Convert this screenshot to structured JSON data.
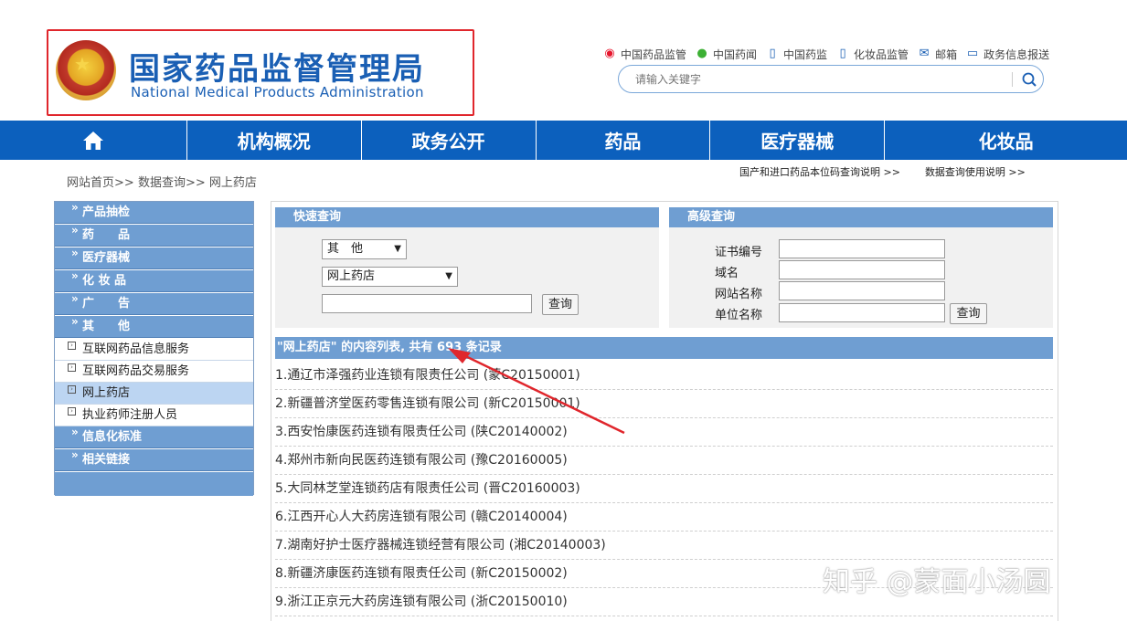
{
  "header": {
    "title_zh": "国家药品监督管理局",
    "title_en": "National Medical Products Administration",
    "quick_links": [
      {
        "label": "中国药品监管",
        "icon": "weibo-icon"
      },
      {
        "label": "中国药闻",
        "icon": "wechat-icon"
      },
      {
        "label": "中国药监",
        "icon": "mobile-icon"
      },
      {
        "label": "化妆品监管",
        "icon": "mobile-icon"
      },
      {
        "label": "邮箱",
        "icon": "mail-icon"
      },
      {
        "label": "政务信息报送",
        "icon": "monitor-icon"
      }
    ],
    "search": {
      "placeholder": "请输入关键字"
    }
  },
  "nav": {
    "items": [
      "机构概况",
      "政务公开",
      "药品",
      "医疗器械",
      "化妆品"
    ]
  },
  "breadcrumb": {
    "items": [
      "网站首页",
      "数据查询",
      "网上药店"
    ],
    "separator": ">>"
  },
  "help_links": [
    "国产和进口药品本位码查询说明 >>",
    "数据查询使用说明 >>"
  ],
  "sidebar": {
    "categories_top": [
      "产品抽检",
      "药　　品",
      "医疗器械",
      "化 妆 品",
      "广　　告",
      "其　　他"
    ],
    "sub_items": [
      "互联网药品信息服务",
      "互联网药品交易服务",
      "网上药店",
      "执业药师注册人员"
    ],
    "active_sub": "网上药店",
    "categories_bottom": [
      "信息化标准",
      "相关链接"
    ]
  },
  "quick_query": {
    "title": "快速查询",
    "type_select": "其　他",
    "db_select": "网上药店",
    "button": "查询"
  },
  "advanced_query": {
    "title": "高级查询",
    "fields": [
      "证书编号",
      "域名",
      "网站名称",
      "单位名称"
    ],
    "button": "查询"
  },
  "result": {
    "header": "\"网上药店\" 的内容列表, 共有 693 条记录",
    "total": 693,
    "rows": [
      "1.通辽市泽强药业连锁有限责任公司 (蒙C20150001)",
      "2.新疆普济堂医药零售连锁有限公司 (新C20150001)",
      "3.西安怡康医药连锁有限责任公司 (陕C20140002)",
      "4.郑州市新向民医药连锁有限公司 (豫C20160005)",
      "5.大同林芝堂连锁药店有限责任公司 (晋C20160003)",
      "6.江西开心人大药房连锁有限公司 (赣C20140004)",
      "7.湖南好护士医疗器械连锁经营有限公司 (湘C20140003)",
      "8.新疆济康医药连锁有限责任公司 (新C20150002)",
      "9.浙江正京元大药房连锁有限公司 (浙C20150010)"
    ]
  },
  "watermark": "知乎 @蒙面小汤圆",
  "colors": {
    "nav": "#0c60bd",
    "panel_head": "#6f9ed2",
    "logo_border": "#e0262c",
    "title": "#1a5fb4",
    "annotation_arrow": "#e0262c"
  }
}
